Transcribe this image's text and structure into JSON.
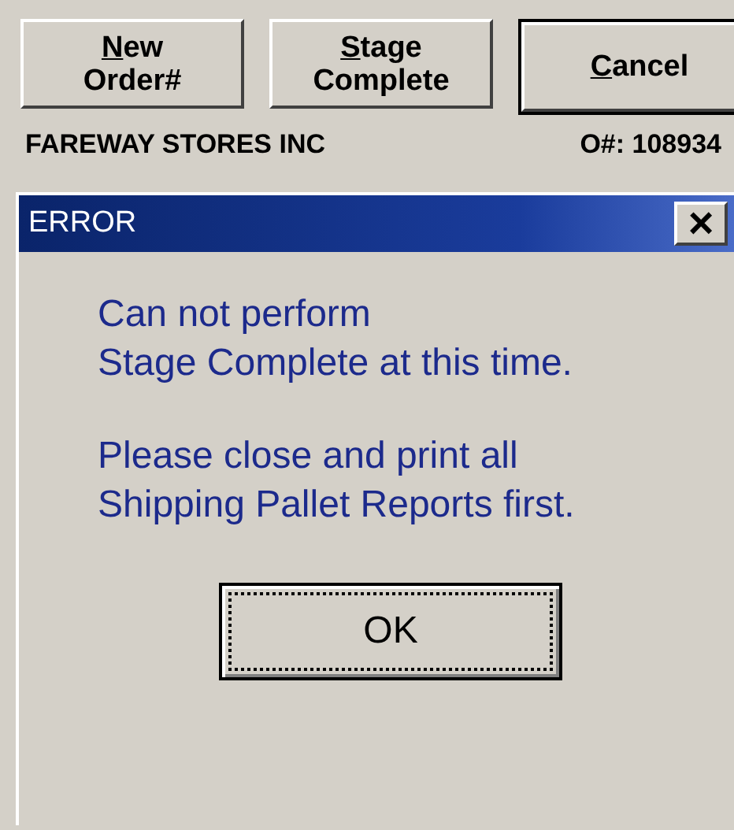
{
  "toolbar": {
    "buttons": [
      {
        "lines": [
          "New",
          "Order#"
        ],
        "underline_first": true,
        "default": false
      },
      {
        "lines": [
          "Stage",
          "Complete"
        ],
        "underline_first": true,
        "default": false
      },
      {
        "lines": [
          "Cancel"
        ],
        "underline_first": true,
        "default": true
      }
    ]
  },
  "info": {
    "customer": "FAREWAY STORES INC",
    "order": "O#: 108934"
  },
  "dialog": {
    "title": "ERROR",
    "close": "×",
    "messages": [
      "Can not perform\nStage Complete at this time.",
      "Please close and print all\nShipping Pallet Reports first."
    ],
    "button": {
      "label": "OK",
      "focused": true
    }
  }
}
